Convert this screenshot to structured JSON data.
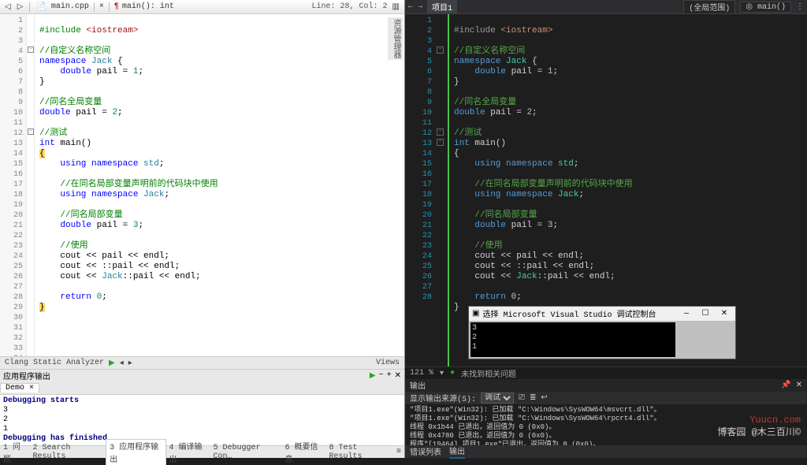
{
  "left": {
    "toolbar": {
      "file": "main.cpp",
      "func": "main(): int",
      "status": "Line: 28, Col: 2"
    },
    "gutter": [
      1,
      2,
      3,
      4,
      5,
      6,
      7,
      8,
      9,
      10,
      11,
      12,
      13,
      14,
      15,
      16,
      17,
      18,
      19,
      20,
      21,
      22,
      23,
      24,
      25,
      26,
      27,
      28,
      29,
      30,
      31,
      32,
      33,
      34
    ],
    "analyzer": "Clang Static Analyzer",
    "views": "Views",
    "out_label": "应用程序输出",
    "demo_tab": "Demo",
    "output": [
      "Debugging starts",
      "3",
      "2",
      "1",
      "Debugging has finished"
    ],
    "bottom_tabs": [
      "1 问题",
      "2 Search Results",
      "3 应用程序输出",
      "4 编译输出",
      "5 Debugger Con…",
      "6 概要信息",
      "8 Test Results"
    ]
  },
  "code": {
    "l1_a": "#include",
    "l1_b": "<iostream>",
    "l3": "//自定义名称空间",
    "l4_a": "namespace",
    "l4_b": "Jack",
    "l4_c": "{",
    "l5_a": "double",
    "l5_b": "pail = ",
    "l5_c": "1",
    "l5_d": ";",
    "l6": "}",
    "l8": "//同名全局变量",
    "l9_a": "double",
    "l9_b": "pail = ",
    "l9_c": "2",
    "l9_d": ";",
    "l11": "//测试",
    "l12_a": "int",
    "l12_b": "main",
    "l12_c": "()",
    "l13": "{",
    "l14_a": "using namespace",
    "l14_b": "std",
    "l14_c": ";",
    "l16": "//在同名局部变量声明前的代码块中使用",
    "l17_a": "using namespace",
    "l17_b": "Jack",
    "l17_c": ";",
    "l19": "//同名局部变量",
    "l20_a": "double",
    "l20_b": "pail = ",
    "l20_c": "3",
    "l20_d": ";",
    "l22": "//使用",
    "l23": "cout << pail << endl;",
    "l24": "cout << ::pail << endl;",
    "l25_a": "cout << ",
    "l25_b": "Jack",
    "l25_c": "::pail << endl;",
    "l27_a": "return",
    "l27_b": "0",
    "l27_c": ";",
    "l28": "}"
  },
  "right": {
    "tab": "项目1",
    "scope": "(全局范围)",
    "func": "main()",
    "gutter": [
      1,
      2,
      3,
      4,
      5,
      6,
      7,
      8,
      9,
      10,
      11,
      12,
      13,
      14,
      15,
      16,
      17,
      18,
      19,
      20,
      21,
      22,
      23,
      24,
      25,
      26,
      27,
      28
    ],
    "float_title": "选择 Microsoft Visual Studio 调试控制台",
    "float_lines": [
      "3",
      "2",
      "1"
    ],
    "zoom": "121 %",
    "no_issues": "未找到相关问题",
    "out_header": "输出",
    "out_from": "显示输出来源(S):",
    "out_select": "调试",
    "out_lines": [
      "\"项目1.exe\"(Win32): 已加载 \"C:\\Windows\\SysWOW64\\msvcrt.dll\"。",
      "\"项目1.exe\"(Win32): 已加载 \"C:\\Windows\\SysWOW64\\rpcrt4.dll\"。",
      "线程 0x1b44 已退出，返回值为 0 (0x0)。",
      "线程 0x4780 已退出，返回值为 0 (0x0)。",
      "程序\"[19464] 项目1.exe\"已退出，返回值为 0 (0x0)。"
    ],
    "bottom_tabs": [
      "错误列表",
      "输出"
    ]
  },
  "watermark": {
    "a": "Yuucn.com",
    "b": "博客园 @木三百川©"
  }
}
